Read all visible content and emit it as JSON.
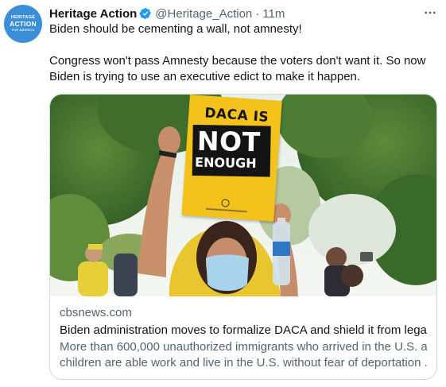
{
  "author": {
    "name": "Heritage Action",
    "handle": "@Heritage_Action",
    "time": "11m",
    "avatar_text": [
      "HERITAGE",
      "ACTION",
      "FOR AMERICA"
    ],
    "avatar_color": "#3b8fd9",
    "verified_icon": "verified-badge-icon",
    "verified_color": "#1d9bf0"
  },
  "tweet": {
    "line1": "Biden should be cementing a wall, not amnesty!",
    "line2": "Congress won't pass Amnesty because the voters don't want it. So now",
    "line3": "Biden is trying to use an executive edict to make it happen."
  },
  "more_icon": "more-horizontal-icon",
  "card": {
    "domain": "cbsnews.com",
    "title": "Biden administration moves to formalize DACA and shield it from legal...",
    "desc_line1": "More than 600,000 unauthorized immigrants who arrived in the U.S. as",
    "desc_line2": "children are able work and live in the U.S. without fear of deportation ...",
    "photo": {
      "sign_line1": "DACA IS",
      "sign_line2": "NOT",
      "sign_line3": "ENOUGH",
      "sign_color": "#f3c21b"
    }
  }
}
